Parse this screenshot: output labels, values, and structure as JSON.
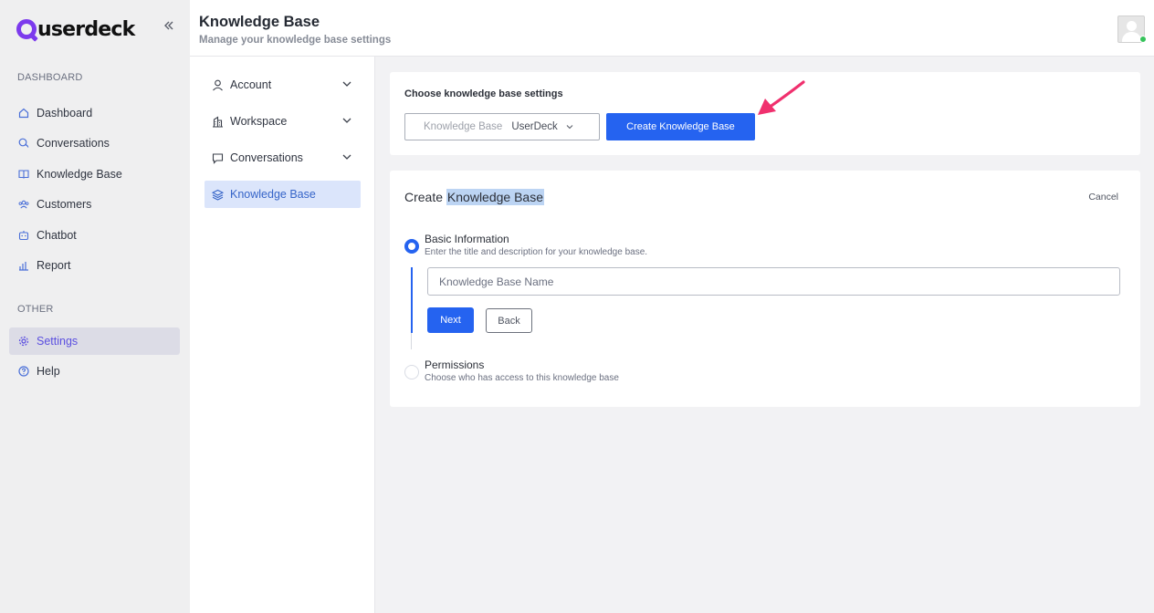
{
  "app": {
    "logo_text": "userdeck"
  },
  "sidebar": {
    "section_dashboard": "DASHBOARD",
    "section_other": "OTHER",
    "items": [
      {
        "label": "Dashboard",
        "icon": "home-icon"
      },
      {
        "label": "Conversations",
        "icon": "chat-icon"
      },
      {
        "label": "Knowledge Base",
        "icon": "book-icon"
      },
      {
        "label": "Customers",
        "icon": "users-icon"
      },
      {
        "label": "Chatbot",
        "icon": "bot-icon"
      },
      {
        "label": "Report",
        "icon": "chart-icon"
      }
    ],
    "other_items": [
      {
        "label": "Settings",
        "icon": "gear-icon",
        "active": true
      },
      {
        "label": "Help",
        "icon": "help-icon"
      }
    ]
  },
  "header": {
    "title": "Knowledge Base",
    "subtitle": "Manage your knowledge base settings"
  },
  "settings_nav": {
    "items": [
      {
        "label": "Account",
        "icon": "user-icon",
        "expandable": true
      },
      {
        "label": "Workspace",
        "icon": "building-icon",
        "expandable": true
      },
      {
        "label": "Conversations",
        "icon": "message-icon",
        "expandable": true
      },
      {
        "label": "Knowledge Base",
        "icon": "layers-icon",
        "active": true
      }
    ]
  },
  "kb_settings": {
    "heading": "Choose knowledge base settings",
    "select_label": "Knowledge Base",
    "select_value": "UserDeck",
    "create_button": "Create Knowledge Base"
  },
  "create_form": {
    "title_prefix": "Create",
    "title_highlight": "Knowledge Base",
    "cancel": "Cancel",
    "step1": {
      "title": "Basic Information",
      "description": "Enter the title and description for your knowledge base.",
      "input_placeholder": "Knowledge Base Name",
      "input_value": "",
      "next": "Next",
      "back": "Back"
    },
    "step2": {
      "title": "Permissions",
      "description": "Choose who has access to this knowledge base"
    }
  },
  "colors": {
    "brand": "#7c3aed",
    "primary": "#2563f0",
    "active_bg": "#dbe5fb",
    "annotation_arrow": "#f0306e",
    "online": "#35c35a"
  }
}
